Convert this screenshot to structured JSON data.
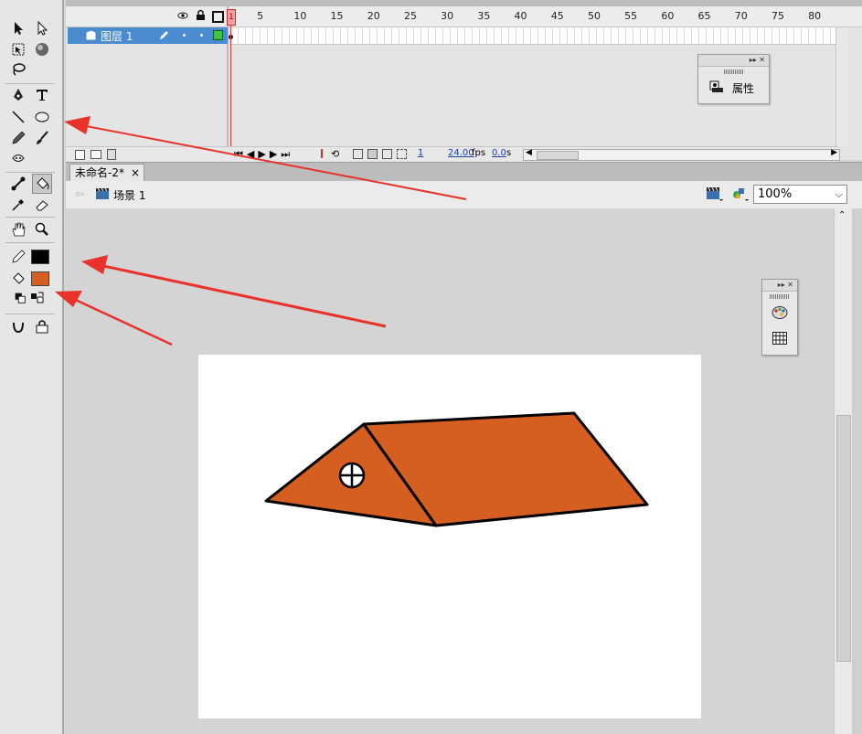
{
  "timeline": {
    "frame_numbers": [
      "1",
      "5",
      "10",
      "15",
      "20",
      "25",
      "30",
      "35",
      "40",
      "45",
      "50",
      "55",
      "60",
      "65",
      "70",
      "75",
      "80"
    ],
    "layer_name": "图层 1",
    "footer": {
      "current_frame": "1",
      "fps": "24.00",
      "fps_unit": "fps",
      "time": "0.0",
      "time_unit": "s"
    }
  },
  "properties_panel": {
    "label": "属性"
  },
  "document": {
    "tab_label": "未命名-2*",
    "close_glyph": "×",
    "scene_label": "场景 1",
    "zoom": "100%"
  },
  "swatches": {
    "stroke": "#000000",
    "fill": "#d55f21"
  },
  "icons": {
    "toolbar": [
      "selection-arrow-icon",
      "subselection-icon",
      "free-transform-icon",
      "3d-rotation-icon",
      "lasso-icon",
      "pen-icon",
      "text-icon",
      "line-icon",
      "oval-icon",
      "pencil-icon",
      "brush-icon",
      "deco-icon",
      "bone-icon",
      "paint-bucket-icon",
      "eyedropper-icon",
      "eraser-icon",
      "hand-icon",
      "zoom-icon",
      "stroke-color-icon",
      "fill-color-icon",
      "swap-colors-icon",
      "snap-icon",
      "lock-icon"
    ]
  },
  "accent_colors": {
    "layer_selected": "#4b8bd0",
    "playhead": "#e03030",
    "annotation_arrow": "#e8322a",
    "roof": "#d55f21"
  }
}
